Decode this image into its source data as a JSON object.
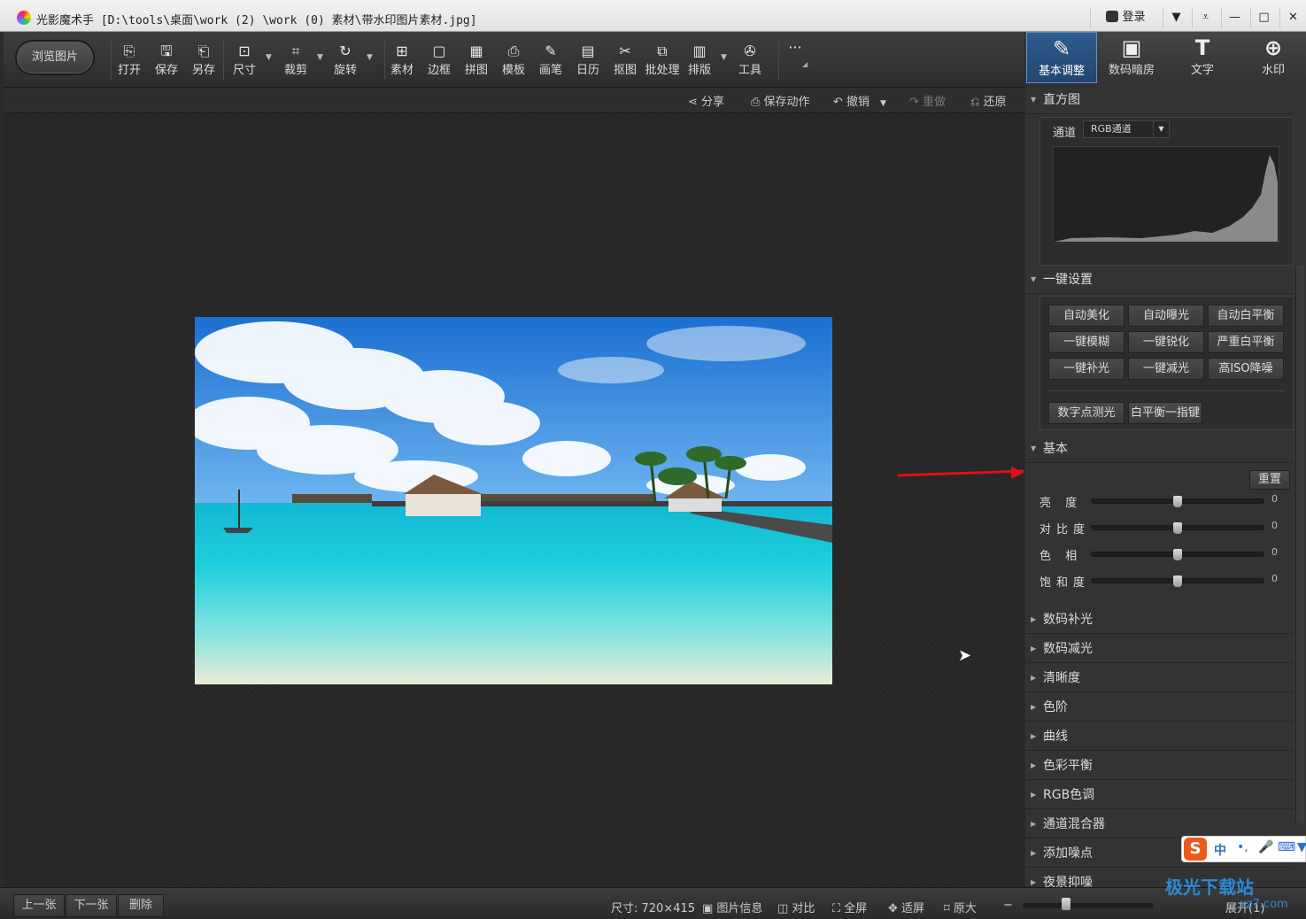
{
  "window": {
    "title": "光影魔术手 [D:\\tools\\桌面\\work (2) \\work (0) 素材\\带水印图片素材.jpg]",
    "login": "登录",
    "controls": [
      "shirt-icon",
      "dropdown-icon",
      "minimize-icon",
      "maximize-icon",
      "close-icon"
    ]
  },
  "toolbar": {
    "browse": "浏览图片",
    "tools": [
      {
        "label": "打开",
        "icon": "open-icon"
      },
      {
        "label": "保存",
        "icon": "save-icon"
      },
      {
        "label": "另存",
        "icon": "save-as-icon"
      },
      {
        "label": "尺寸",
        "icon": "resize-icon"
      },
      {
        "label": "裁剪",
        "icon": "crop-icon"
      },
      {
        "label": "旋转",
        "icon": "rotate-icon"
      },
      {
        "label": "素材",
        "icon": "material-icon"
      },
      {
        "label": "边框",
        "icon": "border-icon"
      },
      {
        "label": "拼图",
        "icon": "collage-icon"
      },
      {
        "label": "模板",
        "icon": "template-icon"
      },
      {
        "label": "画笔",
        "icon": "brush-icon"
      },
      {
        "label": "日历",
        "icon": "calendar-icon"
      },
      {
        "label": "抠图",
        "icon": "cutout-icon"
      },
      {
        "label": "批处理",
        "icon": "batch-icon"
      },
      {
        "label": "排版",
        "icon": "layout-icon"
      },
      {
        "label": "工具",
        "icon": "tools-icon"
      }
    ],
    "more": "···"
  },
  "actions": {
    "share": "分享",
    "save_action": "保存动作",
    "undo": "撤销",
    "redo": "重做",
    "restore": "还原"
  },
  "photo": {
    "description_icon": "beach-photo"
  },
  "panel": {
    "tabs": [
      {
        "label": "基本调整",
        "icon": "basic-adjust-icon"
      },
      {
        "label": "数码暗房",
        "icon": "darkroom-icon"
      },
      {
        "label": "文字",
        "icon": "text-icon"
      },
      {
        "label": "水印",
        "icon": "watermark-icon"
      }
    ],
    "histogram": {
      "title": "直方图",
      "channel_label": "通道",
      "channel_value": "RGB通道"
    },
    "oneclick": {
      "title": "一键设置",
      "buttons": [
        "自动美化",
        "自动曝光",
        "自动白平衡",
        "一键模糊",
        "一键锐化",
        "严重白平衡",
        "一键补光",
        "一键减光",
        "高ISO降噪",
        "数字点测光",
        "白平衡一指键"
      ]
    },
    "basic": {
      "title": "基本",
      "reset": "重置",
      "sliders": [
        {
          "label": "亮度",
          "display": "亮  度",
          "value": "0"
        },
        {
          "label": "对比度",
          "display": "对比度",
          "value": "0"
        },
        {
          "label": "色相",
          "display": "色  相",
          "value": "0"
        },
        {
          "label": "饱和度",
          "display": "饱和度",
          "value": "0"
        }
      ]
    },
    "sections": [
      "数码补光",
      "数码减光",
      "清晰度",
      "色阶",
      "曲线",
      "色彩平衡",
      "RGB色调",
      "通道混合器",
      "添加噪点",
      "夜景抑噪"
    ]
  },
  "status": {
    "prev": "上一张",
    "next": "下一张",
    "delete": "删除",
    "size": "尺寸: 720×415",
    "info": "图片信息",
    "compare": "对比",
    "fullscreen": "全屏",
    "fit": "适屏",
    "original": "原大",
    "expand": "展开(1)"
  },
  "overlay": {
    "ime": "中",
    "site": "极光下载站",
    "site_url": "xz7.com"
  },
  "colors": {
    "accent": "#2e5b8e",
    "arrow": "#e01010"
  }
}
